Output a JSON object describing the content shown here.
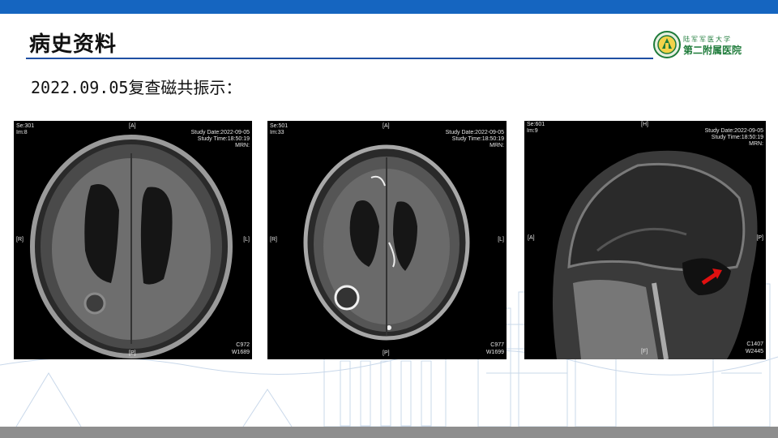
{
  "slide": {
    "title": "病史资料",
    "subtitle": "2022.09.05复查磁共振示：",
    "logo": {
      "icon": "university-emblem-icon",
      "line1": "陆军军医大学",
      "line2": "第二附属医院",
      "color": "#1e7b3a"
    },
    "colors": {
      "accent_bar": "#1565c0",
      "rule": "#1f4fa3",
      "bottom_bar": "#8e8e8e"
    }
  },
  "images": [
    {
      "series": "Se:301",
      "image": "Im:8",
      "top": "[A]",
      "left": "[R]",
      "right": "[L]",
      "bottom": "[P]",
      "study_date": "Study Date:2022-09-05",
      "study_time": "Study Time:18:50:19",
      "mrn": "MRN:",
      "contrast": "C972",
      "window": "W1689"
    },
    {
      "series": "Se:501",
      "image": "Im:33",
      "top": "[A]",
      "left": "[R]",
      "right": "[L]",
      "bottom": "[P]",
      "study_date": "Study Date:2022-09-05",
      "study_time": "Study Time:18:50:19",
      "mrn": "MRN:",
      "contrast": "C977",
      "window": "W1699"
    },
    {
      "series": "Se:601",
      "image": "Im:9",
      "top": "[H]",
      "left": "[A]",
      "right": "[P]",
      "bottom": "[F]",
      "study_date": "Study Date:2022-09-05",
      "study_time": "Study Time:18:50:19",
      "mrn": "MRN:",
      "contrast": "C1407",
      "window": "W2445",
      "annotation": "red-arrow-icon"
    }
  ]
}
